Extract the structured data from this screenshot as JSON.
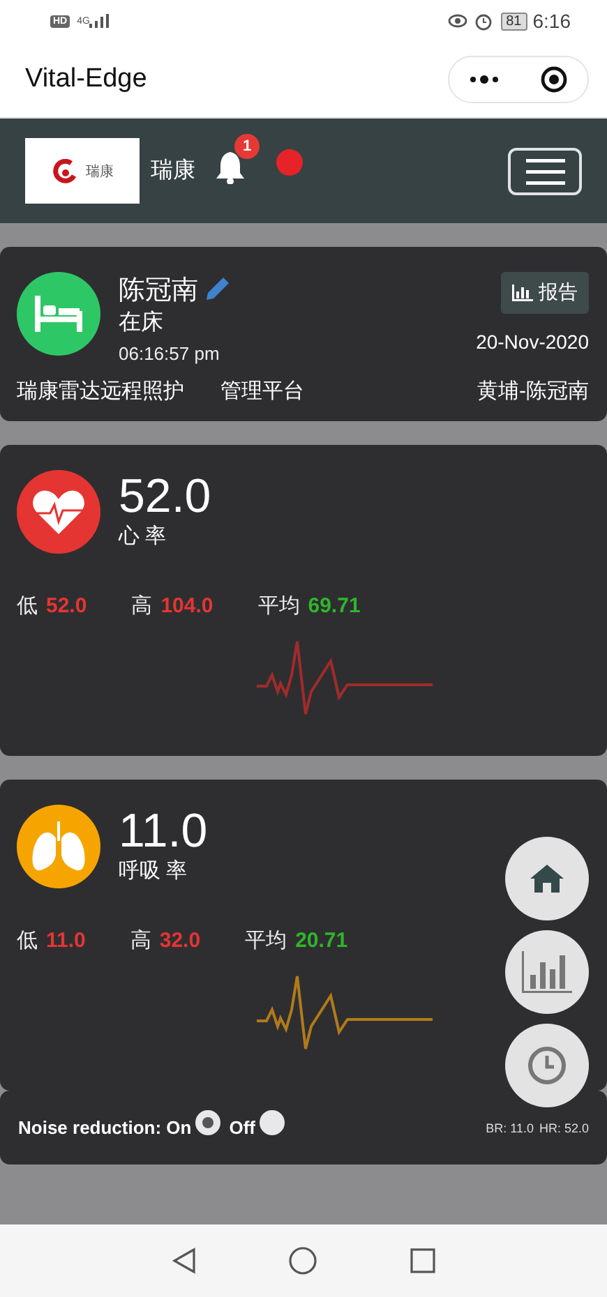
{
  "status_bar": {
    "badge": "HD",
    "network": "4G",
    "battery": "81",
    "time": "6:16"
  },
  "app_bar": {
    "title": "Vital-Edge"
  },
  "header": {
    "logo_text": "瑞康",
    "brand": "瑞康",
    "notification_count": "1"
  },
  "patient": {
    "name": "陈冠南",
    "status": "在床",
    "time": "06:16:57 pm",
    "report_button": "报告",
    "date": "20-Nov-2020",
    "platform": "瑞康雷达远程照护",
    "platform_suffix": "管理平台",
    "location": "黄埔-陈冠南"
  },
  "vitals": [
    {
      "kind": "heart",
      "color": "#e53532",
      "value": "52.0",
      "label": "心 率",
      "low_label": "低",
      "low": "52.0",
      "high_label": "高",
      "high": "104.0",
      "avg_label": "平均",
      "avg": "69.71"
    },
    {
      "kind": "lungs",
      "color": "#f6a500",
      "value": "11.0",
      "label": "呼吸 率",
      "low_label": "低",
      "low": "11.0",
      "high_label": "高",
      "high": "32.0",
      "avg_label": "平均",
      "avg": "20.71"
    }
  ],
  "footer": {
    "noise_label": "Noise reduction: On",
    "options": [
      {
        "selected": true
      },
      {
        "label": "Off",
        "selected": false
      }
    ],
    "readings": [
      "BR: 11.0",
      "HR: 52.0"
    ]
  }
}
